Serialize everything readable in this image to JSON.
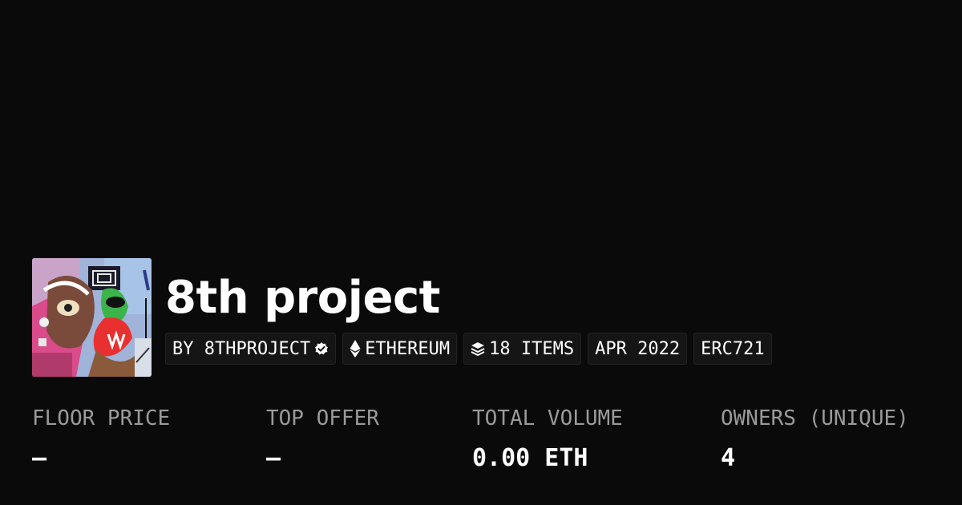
{
  "collection": {
    "name": "8th project",
    "avatar_icon": "collection-artwork"
  },
  "tags": {
    "creator": "BY 8THPROJECT",
    "creator_badge_icon": "verified-badge-icon",
    "chain": "ETHEREUM",
    "chain_icon": "ethereum-icon",
    "items": "18 ITEMS",
    "items_icon": "layers-icon",
    "date": "APR 2022",
    "standard": "ERC721"
  },
  "stats": {
    "floor_price": {
      "label": "FLOOR PRICE",
      "value": "–"
    },
    "top_offer": {
      "label": "TOP OFFER",
      "value": "–"
    },
    "total_volume": {
      "label": "TOTAL VOLUME",
      "value": "0.00 ETH"
    },
    "owners": {
      "label": "OWNERS (UNIQUE)",
      "value": "4"
    }
  },
  "colors": {
    "background": "#0a0a0a",
    "tag_background": "#151515",
    "label_gray": "#9a9a9a",
    "text": "#ffffff"
  }
}
